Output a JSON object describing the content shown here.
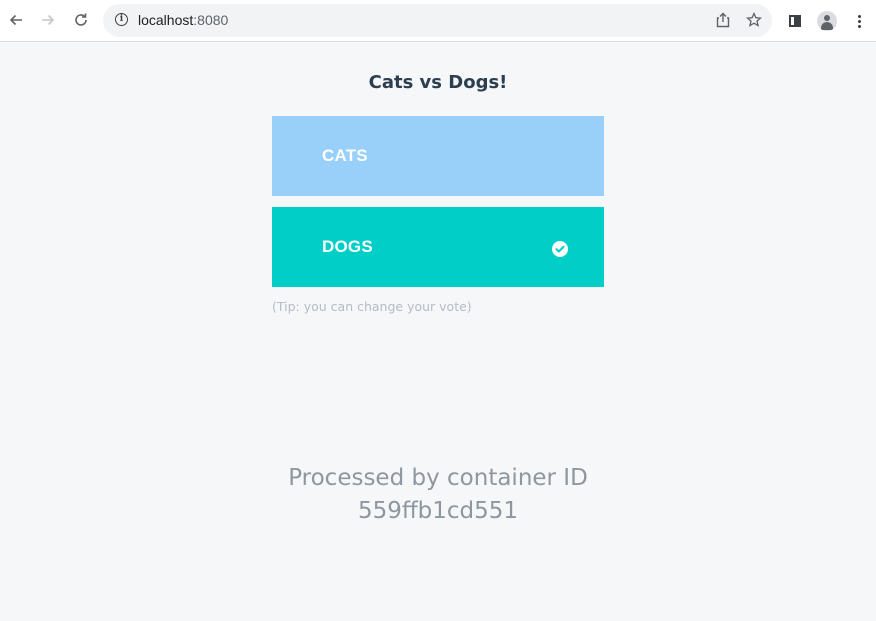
{
  "browser": {
    "url_host": "localhost",
    "url_port": ":8080",
    "icons": {
      "back": "arrow-left-icon",
      "forward": "arrow-right-icon",
      "reload": "reload-icon",
      "site_info": "info-icon",
      "share": "share-icon",
      "bookmark": "star-icon",
      "side_panel": "side-panel-icon",
      "profile": "avatar-icon",
      "menu": "kebab-menu-icon"
    }
  },
  "page": {
    "title": "Cats vs Dogs!",
    "options": [
      {
        "label": "CATS",
        "selected": false,
        "color": "#98d0f9"
      },
      {
        "label": "DOGS",
        "selected": true,
        "color": "#02cec8"
      }
    ],
    "selected_icon": "check-circle-icon",
    "tip": "(Tip: you can change your vote)",
    "footer_line1": "Processed by container ID",
    "footer_line2": "559ffb1cd551"
  },
  "colors": {
    "background": "#f6f7f9",
    "title": "#2c3e50",
    "footer_text": "#8e979f"
  }
}
